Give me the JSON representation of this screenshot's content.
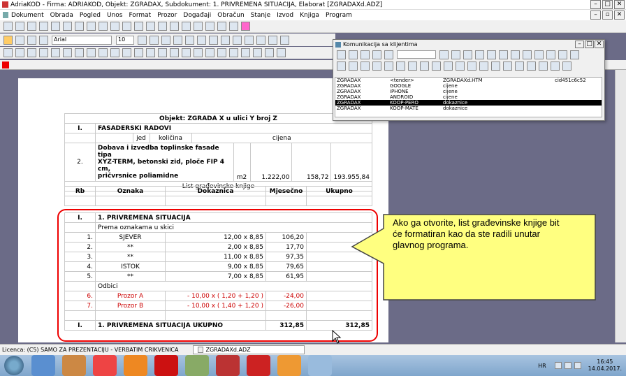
{
  "title": "AdriaKOD - Firma: ADRIAKOD,  Objekt: ZGRADAX,  Subdokument: 1. PRIVREMENA SITUACIJA,  Elaborat [ZGRADAXd.ADZ]",
  "menu": [
    "Dokument",
    "Obrada",
    "Pogled",
    "Unos",
    "Format",
    "Prozor",
    "Događaji",
    "Obračun",
    "Stanje",
    "Izvod",
    "Knjiga",
    "Program"
  ],
  "font": {
    "name": "Arial",
    "size": "10"
  },
  "doc": {
    "header": "Objekt: ZGRADA X u ulici Y broj Z",
    "sec_no": "I.",
    "sec_title": "FASADERSKI RADOVI",
    "cols": [
      "jed",
      "količina",
      "cijena",
      "iznos"
    ],
    "item": {
      "no": "2.",
      "text1": "Dobava i izvedba toplinske fasade tipa",
      "text2": "XYZ-TERM, betonski zid, ploče FIP 4 cm,",
      "text3": "pričvrsnice poliamidne",
      "unit": "m2",
      "qty": "1.222,00",
      "price": "158,72",
      "amount": "193.955,84"
    },
    "list_title": "List građevinske knjige",
    "list_cols": [
      "Rb",
      "Oznaka",
      "Dokaznica",
      "Mjesečno",
      "Ukupno"
    ],
    "situ_no": "I.",
    "situ_title": "1. PRIVREMENA SITUACIJA",
    "prema": "Prema oznakama u skici",
    "rows": [
      {
        "rb": "1.",
        "oz": "SJEVER",
        "dk": "12,00 x 8,85",
        "mj": "106,20"
      },
      {
        "rb": "2.",
        "oz": "**",
        "dk": "2,00 x 8,85",
        "mj": "17,70"
      },
      {
        "rb": "3.",
        "oz": "**",
        "dk": "11,00 x 8,85",
        "mj": "97,35"
      },
      {
        "rb": "4.",
        "oz": "ISTOK",
        "dk": "9,00 x 8,85",
        "mj": "79,65"
      },
      {
        "rb": "5.",
        "oz": "**",
        "dk": "7,00 x 8,85",
        "mj": "61,95"
      }
    ],
    "odbici": "Odbici",
    "red_rows": [
      {
        "rb": "6.",
        "oz": "Prozor A",
        "dk": "- 10,00 x ( 1,20 + 1,20 )",
        "mj": "-24,00"
      },
      {
        "rb": "7.",
        "oz": "Prozor B",
        "dk": "- 10,00 x ( 1,40 + 1,20 )",
        "mj": "-26,00"
      }
    ],
    "total": {
      "no": "I.",
      "title": "1. PRIVREMENA SITUACIJA UKUPNO",
      "mj": "312,85",
      "uk": "312,85"
    }
  },
  "comm": {
    "title": "Komunikacija sa klijentima",
    "rows": [
      [
        "ZGRADAX",
        "<tender>",
        "ZGRADAXd.HTM",
        "cid451c6c52"
      ],
      [
        "ZGRADAX",
        "GOOGLE",
        "cijene",
        ""
      ],
      [
        "ZGRADAX",
        "iPHONE",
        "cijene",
        ""
      ],
      [
        "ZGRADAX",
        "ANDROID",
        "cijene",
        ""
      ],
      [
        "ZGRADAX",
        "KOOP-PERO",
        "dokaznice",
        ""
      ],
      [
        "ZGRADAX",
        "KOOP-MATE",
        "dokaznice",
        ""
      ]
    ]
  },
  "tooltip": "Ako ga otvorite, list građevinske knjige bit će formatiran kao da ste radili unutar glavnog programa.",
  "status": {
    "licence": "Licenca:  (C5) SAMO ZA PREZENTACIJU - VERBATIM CRIKVENICA",
    "file": "ZGRADAXd.ADZ"
  },
  "tray": {
    "lang": "HR",
    "time": "16:45",
    "date": "14.04.2017."
  },
  "colors": {
    "accent_red": "#e00000",
    "tooltip_bg": "#ffff80",
    "selected_row": "#000000"
  }
}
